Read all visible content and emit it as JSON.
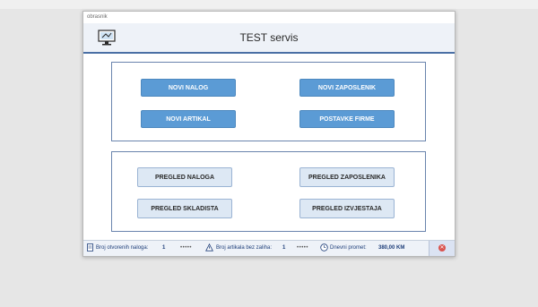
{
  "window": {
    "title": "obrasnik"
  },
  "header": {
    "title": "TEST servis",
    "icon": "computer-monitor-icon"
  },
  "actions": {
    "new_order": "NOVI NALOG",
    "new_employee": "NOVI ZAPOSLENIK",
    "new_article": "NOVI ARTIKAL",
    "company_settings": "POSTAVKE FIRME"
  },
  "reviews": {
    "orders": "PREGLED NALOGA",
    "employees": "PREGLED ZAPOSLENIKA",
    "warehouse": "PREGLED SKLADISTA",
    "reports": "PREGLED IZVJESTAJA"
  },
  "status": {
    "open_orders_label": "Broj otvorenih naloga:",
    "open_orders_value": "1",
    "open_orders_dots": "•••••",
    "no_stock_label": "Broj artikala bez zaliha:",
    "no_stock_value": "1",
    "no_stock_dots": "•••••",
    "daily_label": "Dnevni promet:",
    "daily_value": "380,00 KM",
    "close_symbol": "✕"
  },
  "colors": {
    "accent": "#5b9bd5",
    "border": "#4a6fa5",
    "close": "#d9534f"
  }
}
